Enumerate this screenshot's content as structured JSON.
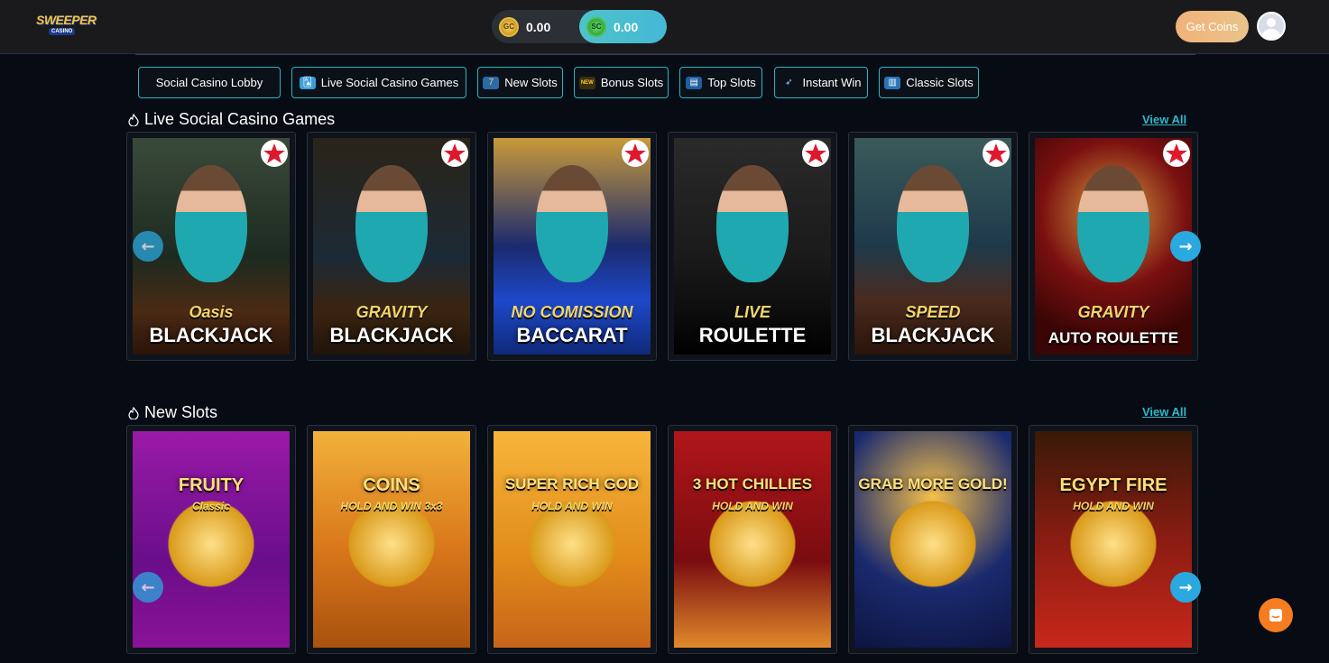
{
  "header": {
    "logo_text": "SWEEPER",
    "logo_sub": "CASINO",
    "wallet": {
      "gc_label": "GC",
      "gc_value": "0.00",
      "sc_label": "SC",
      "sc_value": "0.00"
    },
    "get_coins_label": "Get Coins",
    "accent_color": "#2fb8c9"
  },
  "categories": [
    {
      "label": "Social Casino Lobby",
      "icon": "none"
    },
    {
      "label": "Live Social Casino Games",
      "icon": "cards-icon"
    },
    {
      "label": "New Slots",
      "icon": "slot-machine-icon"
    },
    {
      "label": "Bonus Slots",
      "icon": "new-badge-icon"
    },
    {
      "label": "Top Slots",
      "icon": "slot-reels-icon"
    },
    {
      "label": "Instant Win",
      "icon": "rocket-icon"
    },
    {
      "label": "Classic Slots",
      "icon": "classic-slot-icon"
    }
  ],
  "sections": [
    {
      "title": "Live Social Casino Games",
      "view_all": "View All",
      "games": [
        {
          "name": "BLACKJACK",
          "sub": "Oasis"
        },
        {
          "name": "BLACKJACK",
          "sub": "GRAVITY"
        },
        {
          "name": "BACCARAT",
          "sub": "NO COMISSION"
        },
        {
          "name": "ROULETTE",
          "sub": "LIVE"
        },
        {
          "name": "BLACKJACK",
          "sub": "SPEED"
        },
        {
          "name": "AUTO ROULETTE",
          "sub": "GRAVITY"
        }
      ]
    },
    {
      "title": "New Slots",
      "view_all": "View All",
      "games": [
        {
          "name": "FRUITY",
          "sub": "Classic"
        },
        {
          "name": "COINS",
          "sub": "HOLD AND WIN 3x3"
        },
        {
          "name": "SUPER RICH GOD",
          "sub": "HOLD AND WIN"
        },
        {
          "name": "3 HOT CHILLIES",
          "sub": "HOLD AND WIN"
        },
        {
          "name": "GRAB MORE GOLD!",
          "sub": ""
        },
        {
          "name": "EGYPT FIRE",
          "sub": "HOLD AND WIN"
        }
      ]
    }
  ]
}
